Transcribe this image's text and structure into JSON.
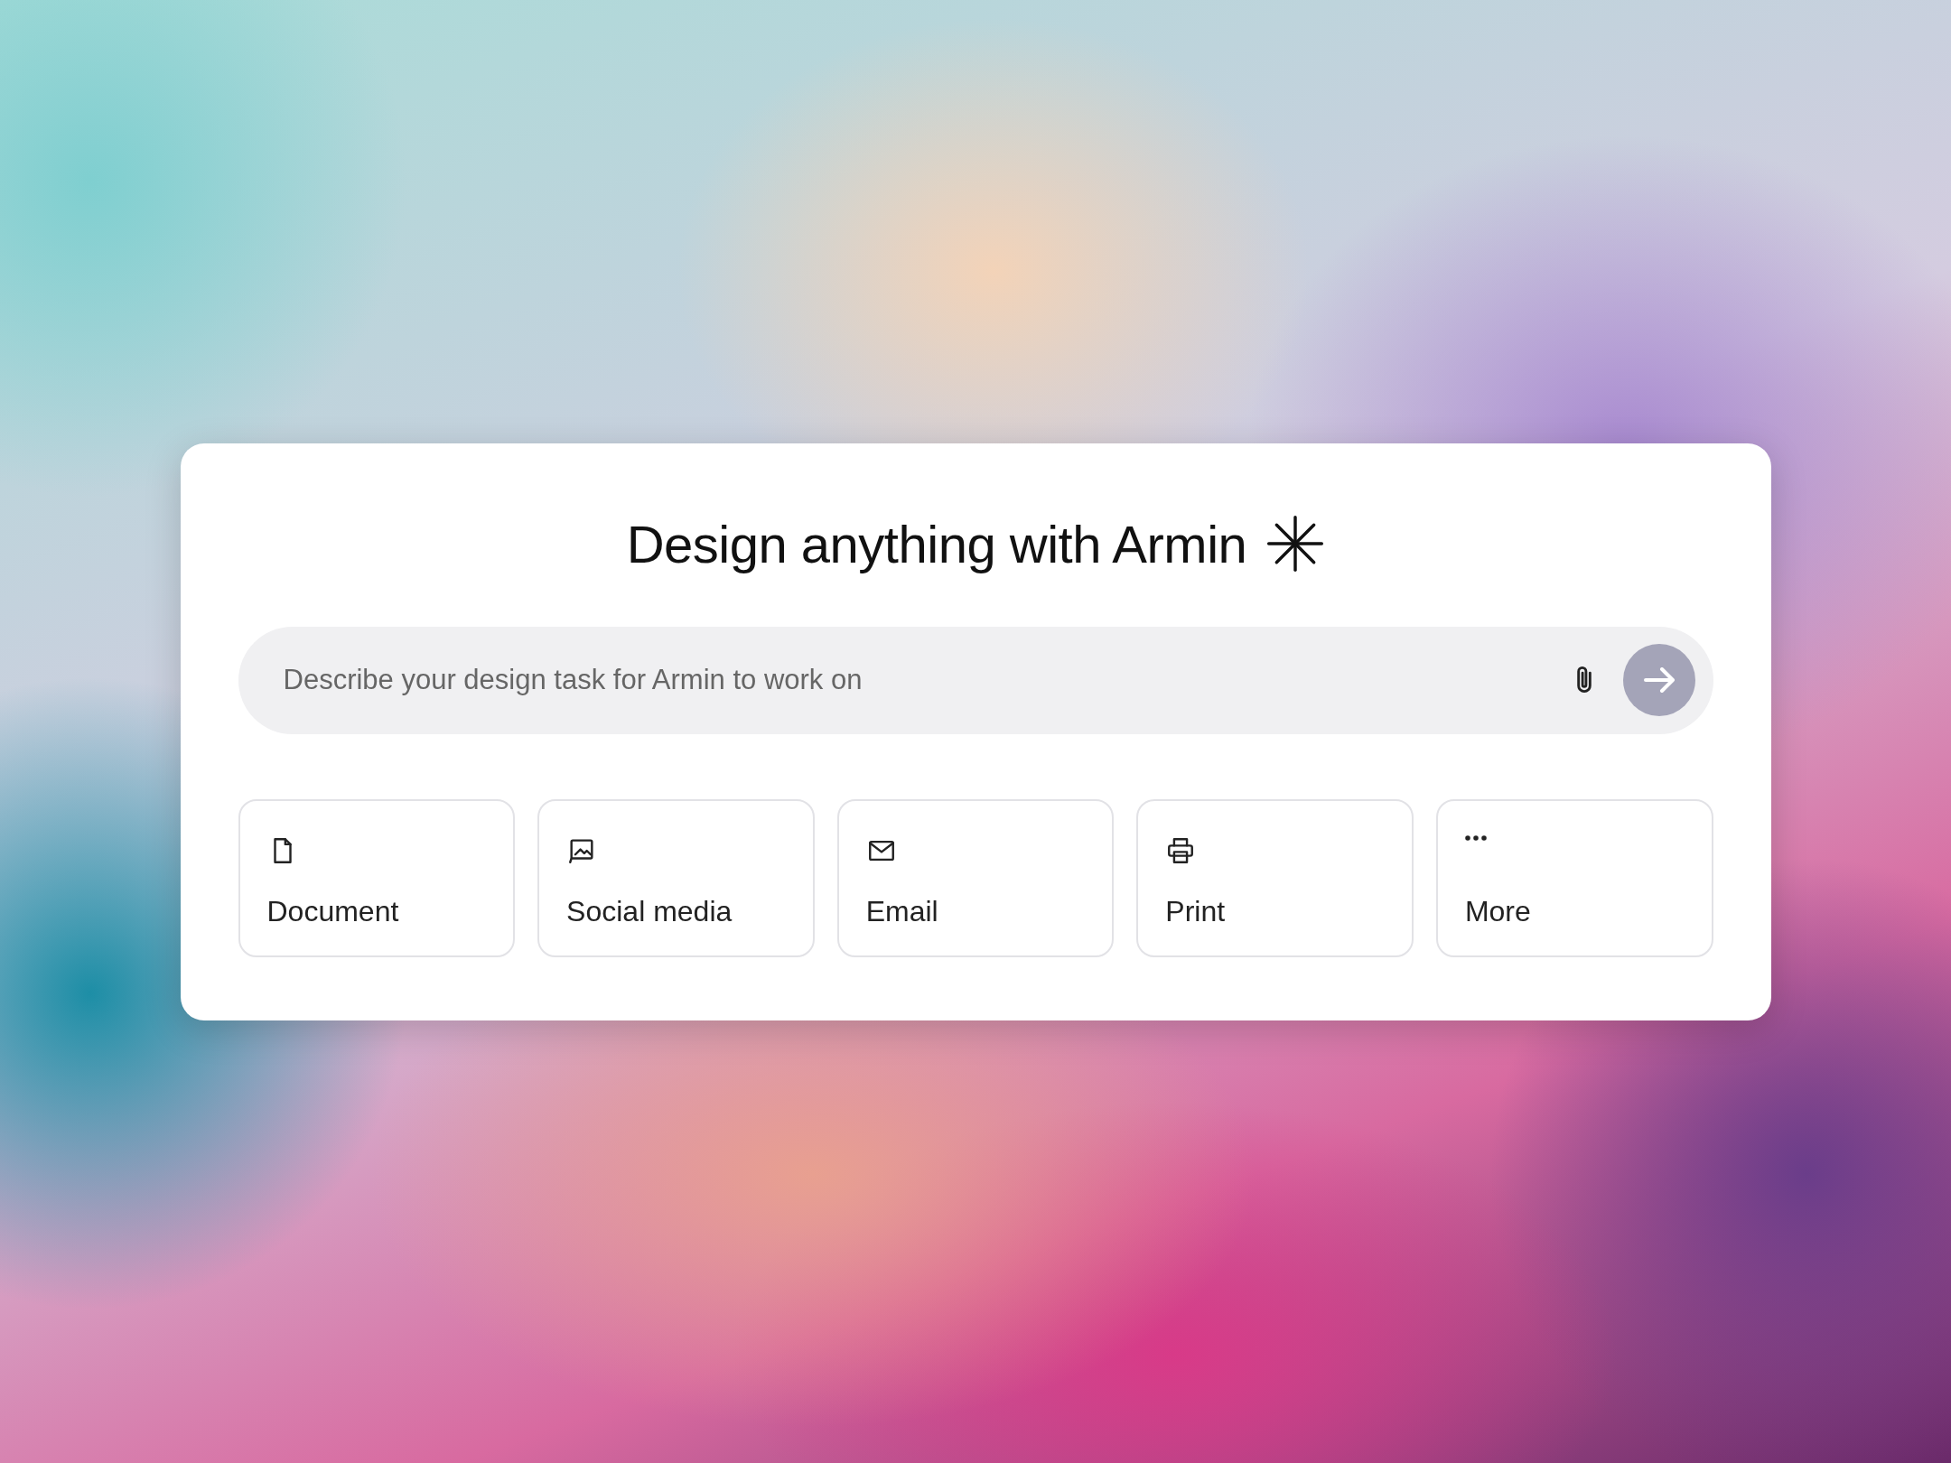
{
  "heading": "Design anything with Armin",
  "prompt": {
    "placeholder": "Describe your design task for Armin to work on"
  },
  "send": {
    "disabled": true
  },
  "categories": [
    {
      "kind": "document",
      "label": "Document"
    },
    {
      "kind": "social",
      "label": "Social media"
    },
    {
      "kind": "email",
      "label": "Email"
    },
    {
      "kind": "print",
      "label": "Print"
    },
    {
      "kind": "more",
      "label": "More"
    }
  ]
}
